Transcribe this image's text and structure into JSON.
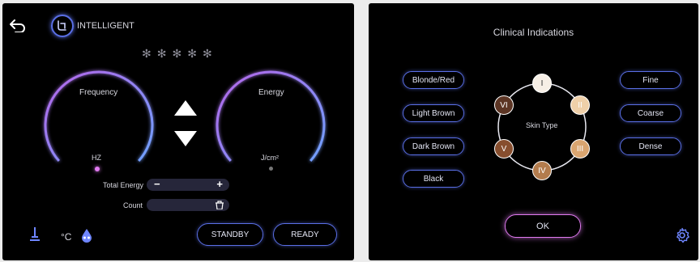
{
  "left": {
    "mode_label": "INTELLIGENT",
    "snowflakes": [
      "✻",
      "✻",
      "✻",
      "✻",
      "✻"
    ],
    "frequency": {
      "label": "Frequency",
      "unit": "HZ"
    },
    "energy": {
      "label": "Energy",
      "unit": "J/cm²"
    },
    "total_energy_label": "Total Energy",
    "minus": "−",
    "plus": "+",
    "count_label": "Count",
    "celsius": "°C",
    "standby_label": "STANDBY",
    "ready_label": "READY"
  },
  "right": {
    "title": "Clinical Indications",
    "hair_colors": [
      "Blonde/Red",
      "Light Brown",
      "Dark Brown",
      "Black"
    ],
    "hair_types": [
      "Fine",
      "Coarse",
      "Dense"
    ],
    "skin_type_label": "Skin Type",
    "skin_types": [
      {
        "label": "I",
        "color": "#f7efe6"
      },
      {
        "label": "II",
        "color": "#efd0a9"
      },
      {
        "label": "III",
        "color": "#d9a570"
      },
      {
        "label": "IV",
        "color": "#b37c4d"
      },
      {
        "label": "V",
        "color": "#874e2e"
      },
      {
        "label": "VI",
        "color": "#5c3524"
      }
    ],
    "ok_label": "OK"
  },
  "colors": {
    "accent_blue": "#5a6fe6",
    "accent_pink": "#e07af0"
  }
}
